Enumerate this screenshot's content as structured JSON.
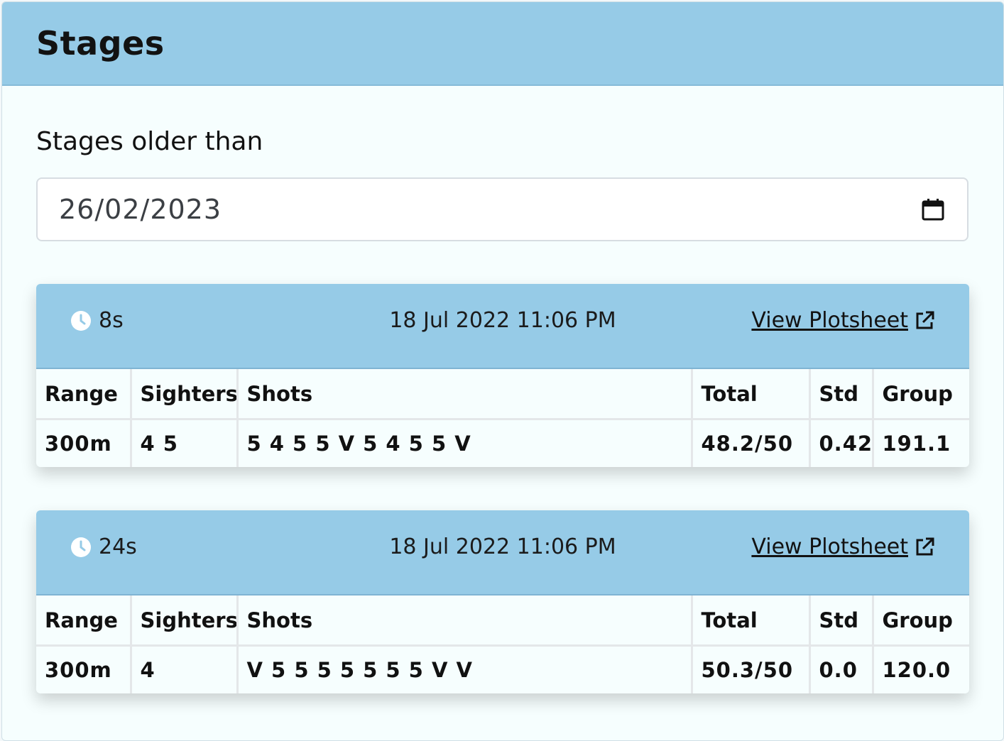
{
  "header": {
    "title": "Stages"
  },
  "filter": {
    "label": "Stages older than",
    "date_value": "26/02/2023",
    "calendar_icon": "calendar-icon"
  },
  "columns": [
    "Range",
    "Sighters",
    "Shots",
    "Total",
    "Std",
    "Group"
  ],
  "stages": [
    {
      "duration": "8s",
      "timestamp": "18 Jul 2022 11:06 PM",
      "link_label": "View Plotsheet",
      "row": {
        "range": "300m",
        "sighters": "4 5",
        "shots": "5 4 5 5 V 5 4 5 5 V",
        "total": "48.2/50",
        "std": "0.42",
        "group": "191.1"
      }
    },
    {
      "duration": "24s",
      "timestamp": "18 Jul 2022 11:06 PM",
      "link_label": "View Plotsheet",
      "row": {
        "range": "300m",
        "sighters": "4",
        "shots": "V 5 5 5 5 5 5 5 V V",
        "total": "50.3/50",
        "std": "0.0",
        "group": "120.0"
      }
    }
  ],
  "colors": {
    "header_bg": "#96cbe7",
    "card_bg": "#f6fefe",
    "clock_icon": "#ffffff"
  }
}
